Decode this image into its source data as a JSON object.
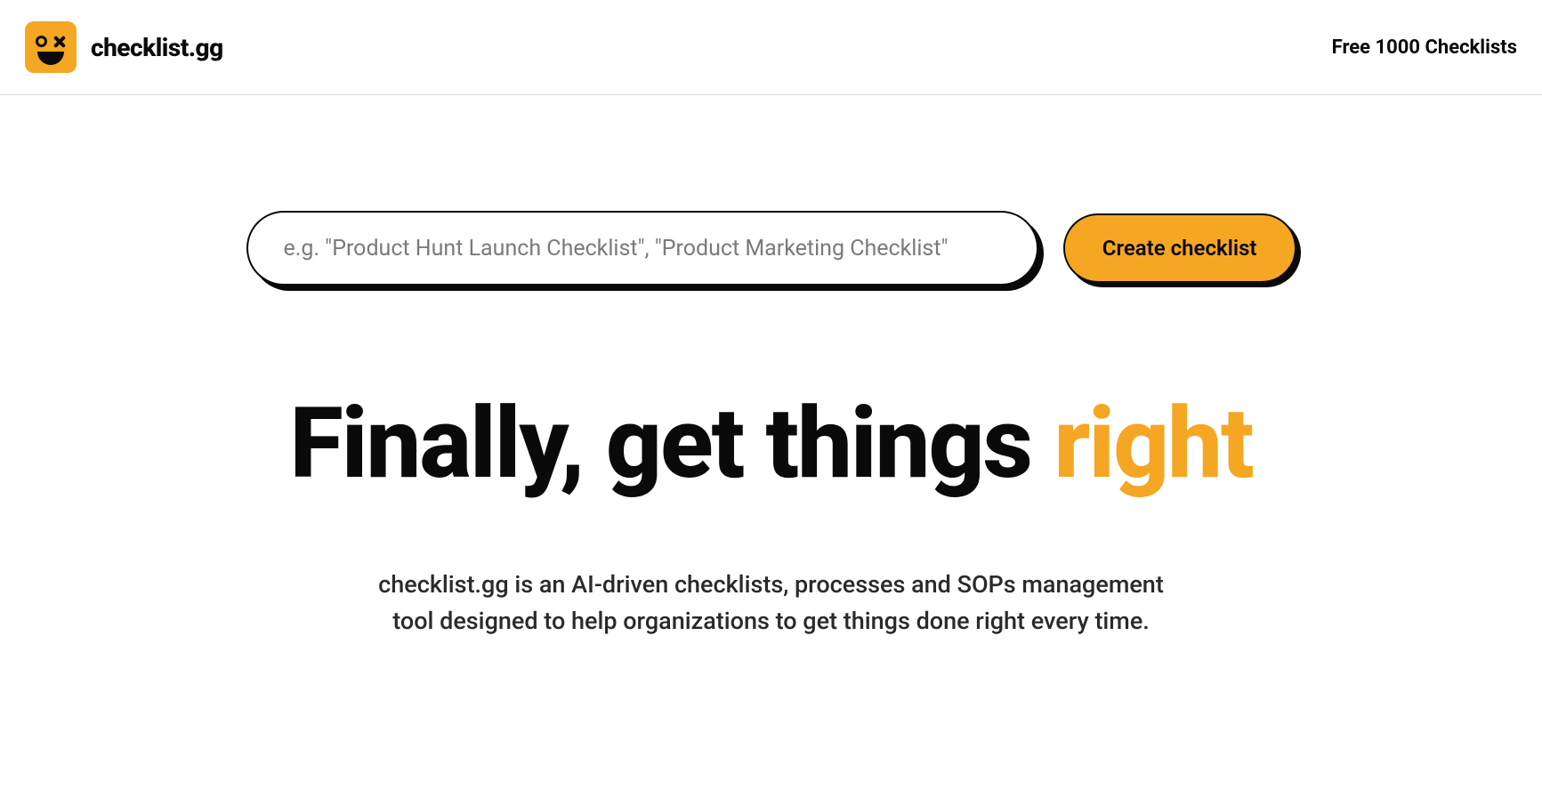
{
  "header": {
    "brand_name": "checklist.gg",
    "nav_link": "Free 1000 Checklists"
  },
  "hero": {
    "search_placeholder": "e.g. \"Product Hunt Launch Checklist\", \"Product Marketing Checklist\"",
    "create_button": "Create checklist",
    "headline_main": "Finally, get things ",
    "headline_accent": "right",
    "subtext": "checklist.gg is an AI-driven checklists, processes and SOPs management tool designed to help organizations to get things done right every time."
  },
  "colors": {
    "accent": "#f5a623",
    "text": "#0a0a0a"
  }
}
